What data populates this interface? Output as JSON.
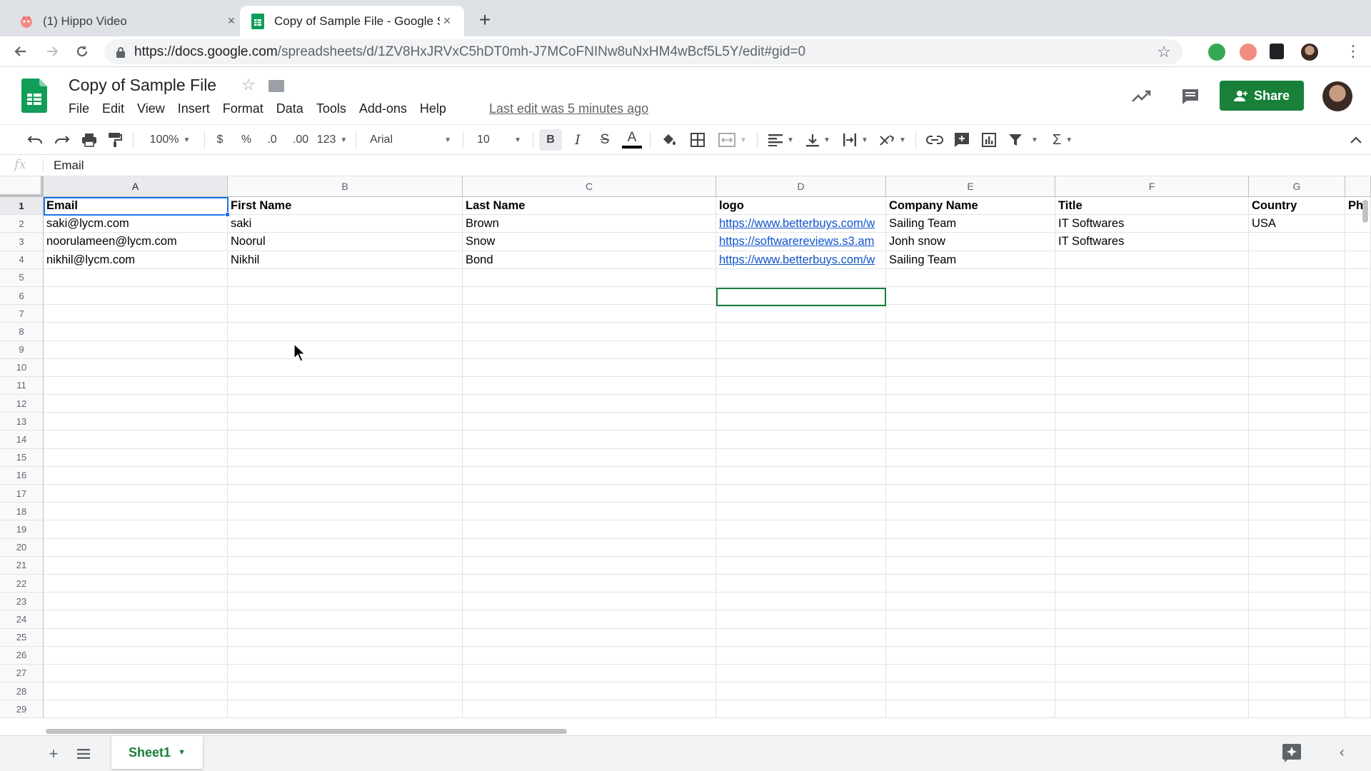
{
  "browser": {
    "tabs": [
      {
        "title": "(1) Hippo Video",
        "close": "×"
      },
      {
        "title": "Copy of Sample File - Google S",
        "close": "×"
      }
    ],
    "new_tab": "+",
    "url_host": "https://docs.google.com",
    "url_path": "/spreadsheets/d/1ZV8HxJRVxC5hDT0mh-J7MCoFNINw8uNxHM4wBcf5L5Y/edit#gid=0"
  },
  "doc": {
    "title": "Copy of Sample File",
    "menu": [
      "File",
      "Edit",
      "View",
      "Insert",
      "Format",
      "Data",
      "Tools",
      "Add-ons",
      "Help"
    ],
    "last_edit": "Last edit was 5 minutes ago",
    "share_label": "Share"
  },
  "toolbar": {
    "zoom": "100%",
    "currency": "$",
    "percent": "%",
    "decimal_decrease": ".0",
    "decimal_increase": ".00",
    "number_format": "123",
    "font": "Arial",
    "font_size": "10",
    "bold": "B",
    "italic": "I",
    "strike": "S",
    "text_color": "A",
    "sigma": "Σ"
  },
  "formula_bar": {
    "fx": "fx",
    "value": "Email"
  },
  "grid": {
    "columns": [
      "A",
      "B",
      "C",
      "D",
      "E",
      "F",
      "G"
    ],
    "partial_column_header": "Ph",
    "rows": [
      [
        "Email",
        "First Name",
        "Last Name",
        "logo",
        "Company Name",
        "Title",
        "Country"
      ],
      [
        "saki@lycm.com",
        "saki",
        "Brown",
        "https://www.betterbuys.com/w",
        "Sailing Team",
        "IT Softwares",
        "USA"
      ],
      [
        "noorulameen@lycm.com",
        "Noorul",
        "Snow",
        "https://softwarereviews.s3.am",
        "Jonh snow",
        "IT Softwares",
        ""
      ],
      [
        "nikhil@lycm.com",
        "Nikhil",
        "Bond",
        "https://www.betterbuys.com/w",
        "Sailing Team",
        "",
        ""
      ]
    ],
    "row_numbers": [
      "1",
      "2",
      "3",
      "4",
      "5",
      "6",
      "7",
      "8",
      "9",
      "10",
      "11",
      "12",
      "13",
      "14",
      "15",
      "16",
      "17",
      "18",
      "19",
      "20",
      "21",
      "22",
      "23",
      "24",
      "25",
      "26",
      "27",
      "28",
      "29"
    ]
  },
  "sheet_tabs": [
    {
      "name": "Sheet1"
    }
  ],
  "colors": {
    "sheets_green": "#188038",
    "selection_blue": "#1a73e8",
    "link_blue": "#1155cc"
  }
}
